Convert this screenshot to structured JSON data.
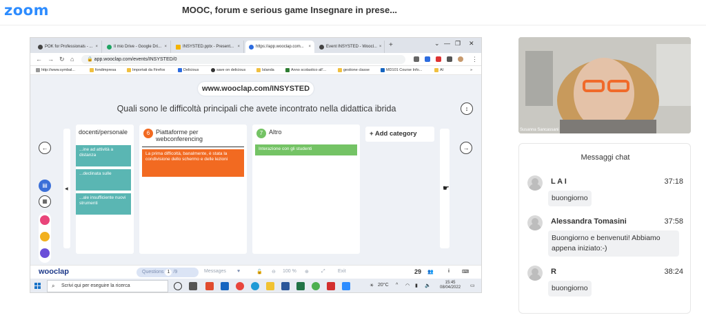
{
  "app": {
    "logo": "zoom",
    "meeting_title": "MOOC, forum e serious game Insegnare in prese..."
  },
  "browser": {
    "tabs": [
      {
        "label": "POK for Professionals - ...",
        "close": "×",
        "color": "#444444"
      },
      {
        "label": "Il mio Drive - Google Dri...",
        "close": "×",
        "color": "#1fa463"
      },
      {
        "label": "INSYSTED.pptx - Present...",
        "close": "×",
        "color": "#f4b400"
      },
      {
        "label": "https://app.wooclap.com...",
        "close": "×",
        "color": "#2d6cdf"
      },
      {
        "label": "Event INSYSTED - Woocl...",
        "close": "×",
        "color": "#444444"
      }
    ],
    "new_tab": "+",
    "window_controls": [
      "⌄",
      "—",
      "❐",
      "✕"
    ],
    "url": "app.wooclap.com/events/INSYSTED/0",
    "bookmarks": [
      "http://www.symbal...",
      "fondimpresa",
      "Importati da Firefox",
      "Delicious",
      "save on delicious",
      "Islanda",
      "Anno scolastico all'...",
      "gestione classe",
      "MD101 Course Info...",
      "AI"
    ],
    "bookmarks_more": "»"
  },
  "wooclap": {
    "join_url": "www.wooclap.com/INSYSTED",
    "question": "Quali sono le difficoltà principali che avete incontrato nella didattica ibrida",
    "columns": [
      {
        "title": "docenti/personale",
        "cards": [
          "...ine ad attività a distanza",
          "...declinata sulle",
          "...ale insufficiente nuovi strumenti"
        ]
      },
      {
        "number": "6",
        "title": "Piattaforme per webconferencing",
        "cards": [
          "La prima difficoltà, banalmente, è stata la condivisione dello schermo e delle lezioni"
        ],
        "color": "#f26a21"
      },
      {
        "number": "7",
        "title": "Altro",
        "cards": [
          "Interazione con gli studenti"
        ],
        "color": "#74c365"
      }
    ],
    "add_category": "+ Add category",
    "bottom": {
      "logo": "wooclap",
      "questions_label": "Questions",
      "question_current": "1",
      "question_total": "/9",
      "messages_label": "Messages",
      "zoom_level": "100 %",
      "exit_label": "Exit",
      "participants": "29"
    }
  },
  "taskbar": {
    "search_placeholder": "Scrivi qui per eseguire la ricerca",
    "temperature": "20°C",
    "time": "15:45",
    "date": "08/04/2022"
  },
  "video": {
    "participant_name": "Susanna Sancassani"
  },
  "chat": {
    "title": "Messaggi chat",
    "messages": [
      {
        "sender": "L A I",
        "time": "37:18",
        "text": "buongiorno"
      },
      {
        "sender": "Alessandra Tomasini",
        "time": "37:58",
        "text": "Buongiorno e benvenuti! Abbiamo appena iniziato:-)"
      },
      {
        "sender": "R",
        "time": "38:24",
        "text": "buongiorno"
      }
    ]
  }
}
